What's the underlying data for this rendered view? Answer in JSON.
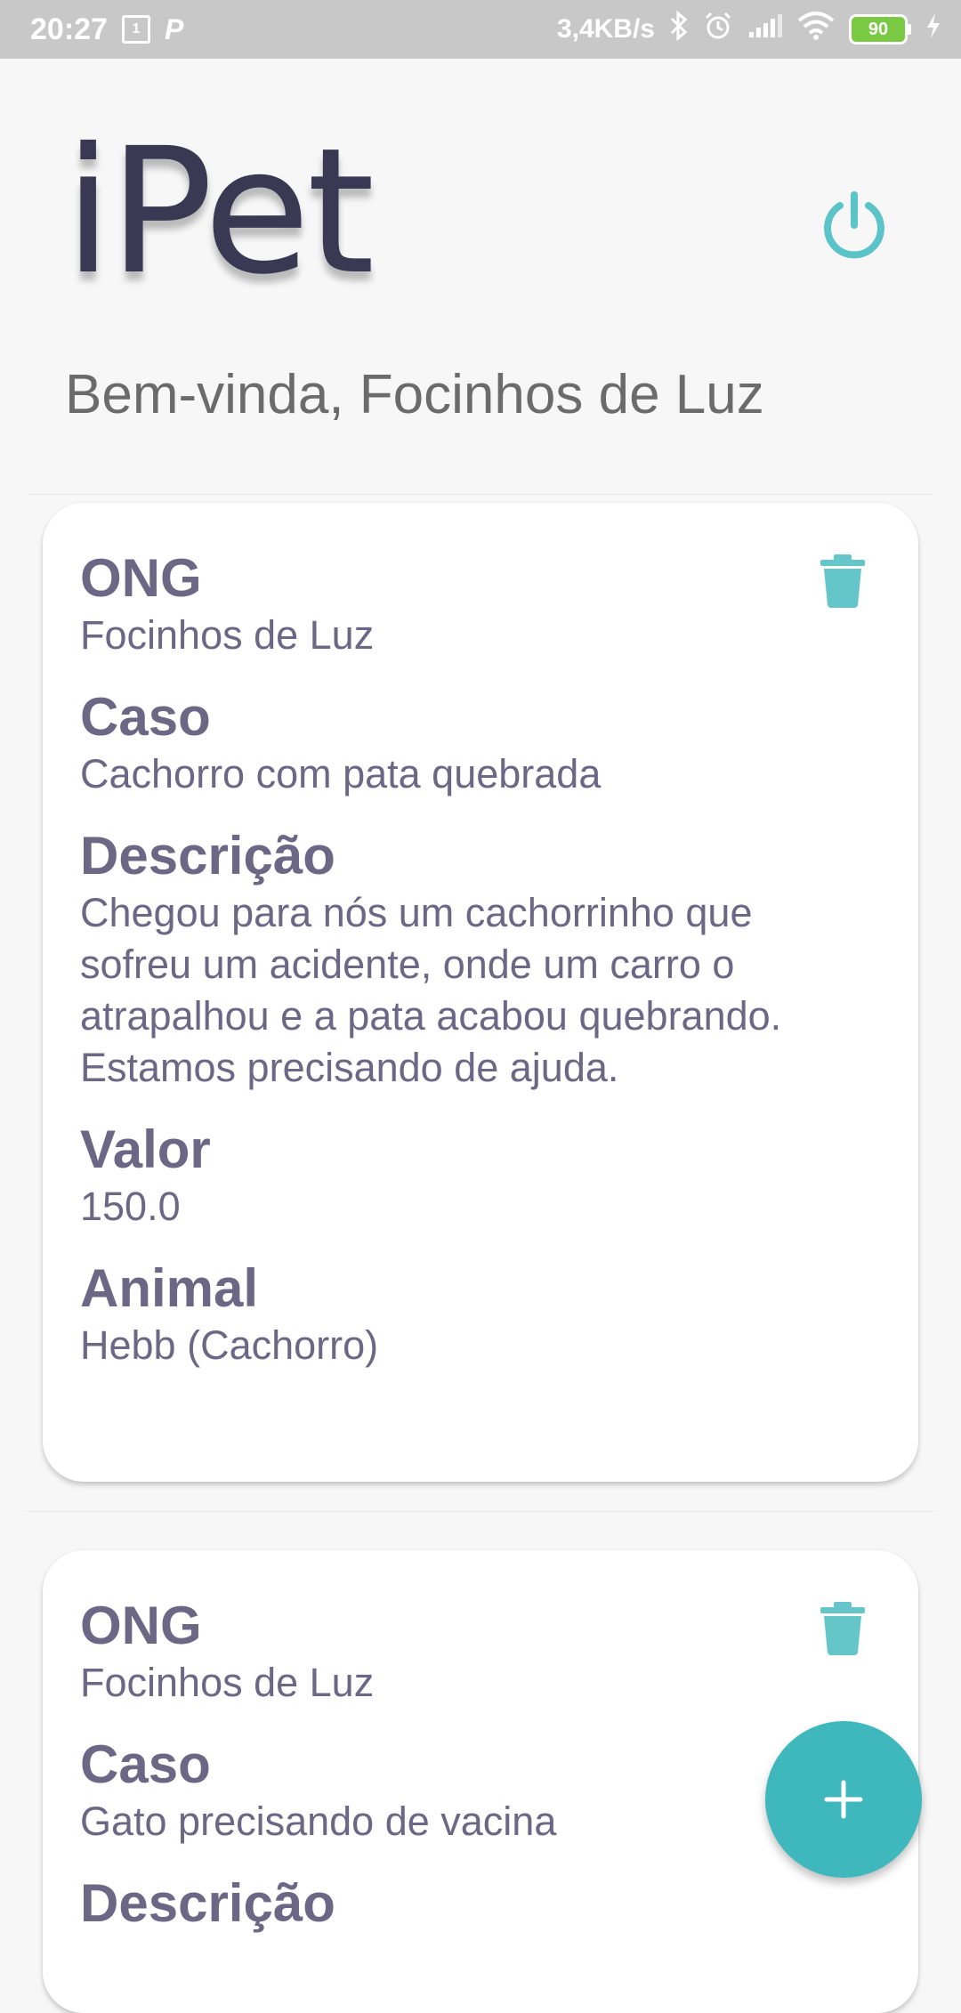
{
  "status_bar": {
    "time": "20:27",
    "sim": "1",
    "p_icon": "P",
    "speed": "3,4KB/s",
    "battery": "90"
  },
  "header": {
    "logo": "iPet",
    "welcome": "Bem-vinda, Focinhos de Luz"
  },
  "cards": [
    {
      "ong_label": "ONG",
      "ong_value": "Focinhos de Luz",
      "caso_label": "Caso",
      "caso_value": "Cachorro com pata quebrada",
      "descricao_label": "Descrição",
      "descricao_lines": [
        "Chegou para nós um cachorrinho que",
        "sofreu um acidente, onde um carro o",
        "atrapalhou e a pata acabou quebrando.",
        "Estamos precisando de ajuda."
      ],
      "valor_label": "Valor",
      "valor_value": "150.0",
      "animal_label": "Animal",
      "animal_value": "Hebb (Cachorro)"
    },
    {
      "ong_label": "ONG",
      "ong_value": "Focinhos de Luz",
      "caso_label": "Caso",
      "caso_value": "Gato precisando de vacina",
      "descricao_label": "Descrição"
    }
  ],
  "colors": {
    "accent": "#3fb8bd",
    "text": "#6b6784",
    "logo": "#3a3853"
  },
  "icons": {
    "power": "power-icon",
    "trash": "trash-icon",
    "add": "plus-icon"
  }
}
